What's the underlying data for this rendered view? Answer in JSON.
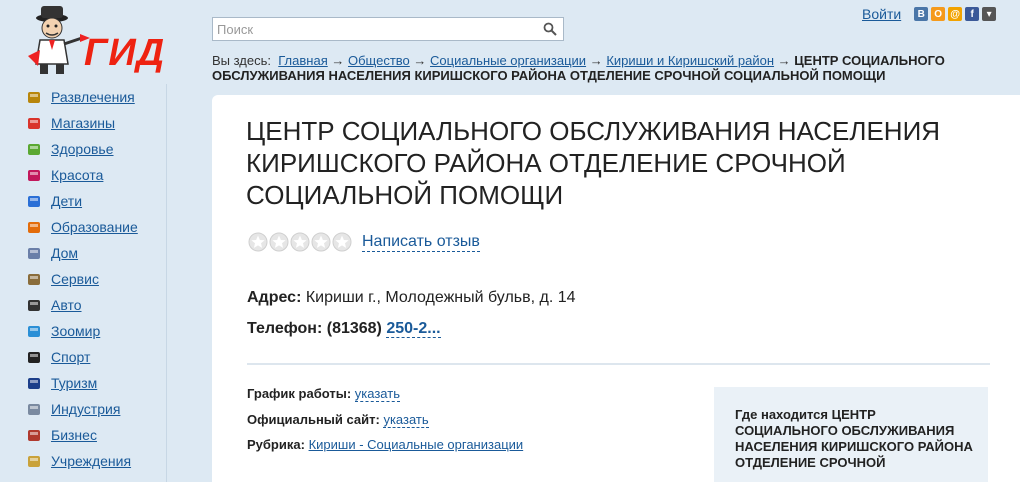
{
  "logo": {
    "text": "ГИД"
  },
  "search": {
    "placeholder": "Поиск"
  },
  "header": {
    "login": "Войти"
  },
  "social": [
    {
      "name": "vkontakte",
      "glyph": "В",
      "color": "#4a76a8"
    },
    {
      "name": "odnoklassniki",
      "glyph": "О",
      "color": "#f59a1c"
    },
    {
      "name": "mailru",
      "glyph": "@",
      "color": "#f2a300"
    },
    {
      "name": "facebook",
      "glyph": "f",
      "color": "#3b5998"
    },
    {
      "name": "more",
      "glyph": "▾",
      "color": "#555555"
    }
  ],
  "sidebar": {
    "items": [
      {
        "label": "Развлечения",
        "icon": "theater-icon",
        "color": "#b8860b"
      },
      {
        "label": "Магазины",
        "icon": "shopping-bag-icon",
        "color": "#d9342b"
      },
      {
        "label": "Здоровье",
        "icon": "apple-icon",
        "color": "#5aa832"
      },
      {
        "label": "Красота",
        "icon": "lipstick-icon",
        "color": "#c2185b"
      },
      {
        "label": "Дети",
        "icon": "toy-blocks-icon",
        "color": "#2a6fd6"
      },
      {
        "label": "Образование",
        "icon": "backpack-icon",
        "color": "#e36c0a"
      },
      {
        "label": "Дом",
        "icon": "house-icon",
        "color": "#6a7fa8"
      },
      {
        "label": "Сервис",
        "icon": "service-bell-icon",
        "color": "#8a6d3b"
      },
      {
        "label": "Авто",
        "icon": "steering-wheel-icon",
        "color": "#333333"
      },
      {
        "label": "Зоомир",
        "icon": "paw-icon",
        "color": "#2a8fd6"
      },
      {
        "label": "Спорт",
        "icon": "soccer-ball-icon",
        "color": "#222222"
      },
      {
        "label": "Туризм",
        "icon": "suitcase-icon",
        "color": "#1c3f8a"
      },
      {
        "label": "Индустрия",
        "icon": "factory-icon",
        "color": "#7a8aa0"
      },
      {
        "label": "Бизнес",
        "icon": "briefcase-icon",
        "color": "#b03a2e"
      },
      {
        "label": "Учреждения",
        "icon": "government-building-icon",
        "color": "#c9a23a"
      }
    ]
  },
  "breadcrumb": {
    "prefix": "Вы здесь:",
    "links": [
      "Главная",
      "Общество",
      "Социальные организации",
      "Кириши и Киришский район"
    ],
    "separator": "→",
    "current": "ЦЕНТР СОЦИАЛЬНОГО ОБСЛУЖИВАНИЯ НАСЕЛЕНИЯ КИРИШСКОГО РАЙОНА ОТДЕЛЕНИЕ СРОЧНОЙ СОЦИАЛЬНОЙ ПОМОЩИ"
  },
  "org": {
    "title": "ЦЕНТР СОЦИАЛЬНОГО ОБСЛУЖИВАНИЯ НАСЕЛЕНИЯ КИРИШСКОГО РАЙОНА ОТДЕЛЕНИЕ СРОЧНОЙ СОЦИАЛЬНОЙ ПОМОЩИ",
    "rating": 0,
    "rating_max": 5,
    "review_link": "Написать отзыв",
    "address_label": "Адрес:",
    "address": "Кириши г., Молодежный бульв, д. 14",
    "phone_label": "Телефон:",
    "phone_code": "(81368)",
    "phone_partial": "250-2..."
  },
  "info": {
    "schedule_label": "График работы:",
    "schedule_value": "указать",
    "site_label": "Официальный сайт:",
    "site_value": "указать",
    "category_label": "Рубрика:",
    "category_value": "Кириши - Социальные организации"
  },
  "map": {
    "title": "Где находится ЦЕНТР СОЦИАЛЬНОГО ОБСЛУЖИВАНИЯ НАСЕЛЕНИЯ КИРИШСКОГО РАЙОНА ОТДЕЛЕНИЕ СРОЧНОЙ"
  }
}
